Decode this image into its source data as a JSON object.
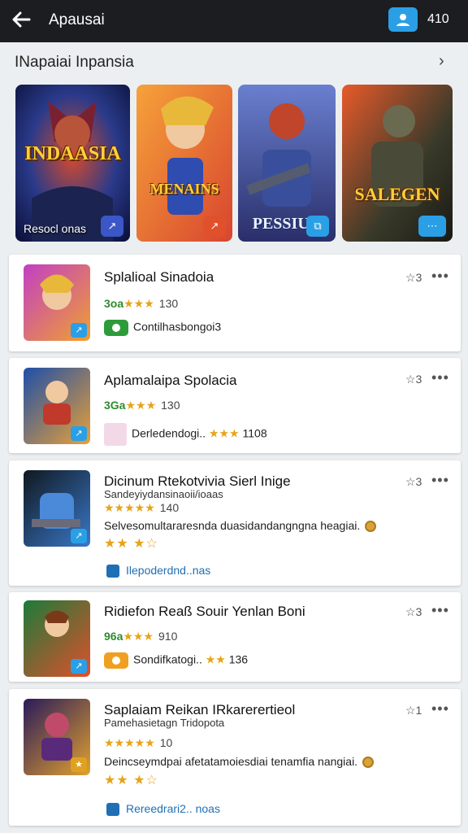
{
  "topbar": {
    "title": "Apausai",
    "count": "410",
    "back_icon": "arrow-left-icon",
    "account_icon": "user-icon"
  },
  "section": {
    "title": "INapaiai Inpansia",
    "chevron_icon": "chevron-right-icon"
  },
  "featured": [
    {
      "logo": "INDAASIA",
      "caption": "Resocl onas",
      "badge_color": "#3b56c7"
    },
    {
      "logo": "MENAINS",
      "caption": "",
      "badge_color": "#e0502b"
    },
    {
      "logo": "PESSIUN",
      "caption": "",
      "badge_color": "#2b9fe6"
    },
    {
      "logo": "SALEGEN",
      "caption": "",
      "badge_color": "#2b9fe6"
    }
  ],
  "apps": [
    {
      "name": "Splalioal Sinadoia",
      "rating_label": "3oa",
      "rating_value": "130",
      "info_text": "Contilhasbongoi3",
      "chip_color": "#2e9b3a",
      "wishlist": "☆3"
    },
    {
      "name": "Aplamalaipa Spolacia",
      "rating_label": "3Ga",
      "rating_value": "130",
      "info_text": "Derledendogi..",
      "info_count": "1108",
      "wishlist": "☆3"
    },
    {
      "name": "Dicinum Rtekotvivia Sierl Inige",
      "subtitle": "Sandeyiydansinaoii/ioaas",
      "rating_value": "140",
      "description": "Selvesomultararesnda duasidandangngna heagiai.",
      "link": "Ilepoderdnd..nas",
      "wishlist": "☆3"
    },
    {
      "name": "Ridiefon Reaß Souir Yenlan Boni",
      "rating_label": "96a",
      "rating_value": "910",
      "info_text": "Sondifkatogi..",
      "info_count": "136",
      "chip_color": "#f0a020",
      "wishlist": "☆3"
    },
    {
      "name": "Saplaiam Reikan IRkarerertieol",
      "subtitle": "Pamehasietagn Tridopota",
      "rating_value": "10",
      "description": "Deincseymdpai afetatamoiesdiai tenamfia nangiai.",
      "link": "Rereedrari2.. noas",
      "wishlist": "☆1"
    }
  ]
}
